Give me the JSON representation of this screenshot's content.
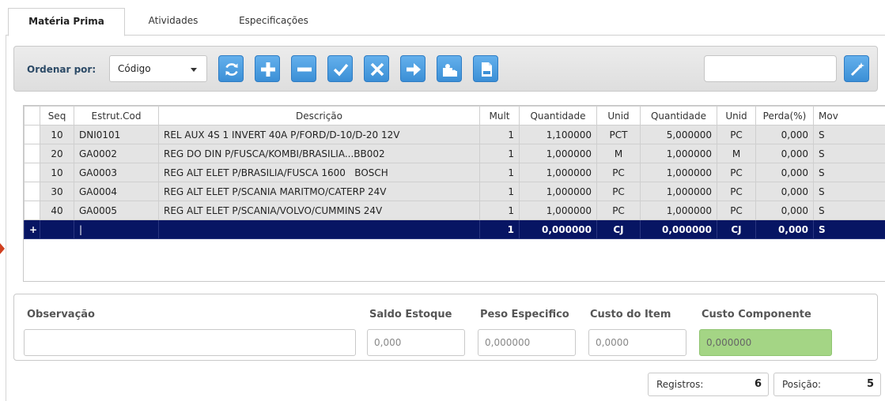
{
  "tabs": [
    {
      "label": "Matéria Prima",
      "active": true
    },
    {
      "label": "Atividades",
      "active": false
    },
    {
      "label": "Especificações",
      "active": false
    }
  ],
  "toolbar": {
    "order_label": "Ordenar por:",
    "order_value": "Código",
    "buttons": [
      "refresh-icon",
      "plus-icon",
      "minus-icon",
      "check-icon",
      "x-icon",
      "arrow-right-icon",
      "puzzle-icon",
      "pdf-icon"
    ],
    "search_value": "",
    "accent": "#3b8fd6"
  },
  "grid": {
    "columns": [
      "",
      "Seq",
      "Estrut.Cod",
      "Descrição",
      "Mult",
      "Quantidade",
      "Unid",
      "Quantidade",
      "Unid",
      "Perda(%)",
      "Mov"
    ],
    "rows": [
      {
        "seq": "10",
        "cod": "DNI0101",
        "desc": "REL AUX 4S 1 INVERT 40A P/FORD/D-10/D-20 12V",
        "mult": "1",
        "qtd1": "1,100000",
        "unid1": "PCT",
        "qtd2": "5,000000",
        "unid2": "PC",
        "perda": "0,000",
        "mov": "S"
      },
      {
        "seq": "20",
        "cod": "GA0002",
        "desc": "REG DO DIN P/FUSCA/KOMBI/BRASILIA...BB002",
        "mult": "1",
        "qtd1": "1,000000",
        "unid1": "M",
        "qtd2": "1,000000",
        "unid2": "M",
        "perda": "0,000",
        "mov": "S"
      },
      {
        "seq": "10",
        "cod": "GA0003",
        "desc": "REG ALT ELET P/BRASILIA/FUSCA 1600   BOSCH",
        "mult": "1",
        "qtd1": "1,000000",
        "unid1": "PC",
        "qtd2": "1,000000",
        "unid2": "PC",
        "perda": "0,000",
        "mov": "S"
      },
      {
        "seq": "30",
        "cod": "GA0004",
        "desc": "REG ALT ELET P/SCANIA MARITMO/CATERP 24V",
        "mult": "1",
        "qtd1": "1,000000",
        "unid1": "PC",
        "qtd2": "1,000000",
        "unid2": "PC",
        "perda": "0,000",
        "mov": "S"
      },
      {
        "seq": "40",
        "cod": "GA0005",
        "desc": "REG ALT ELET P/SCANIA/VOLVO/CUMMINS 24V",
        "mult": "1",
        "qtd1": "1,000000",
        "unid1": "PC",
        "qtd2": "1,000000",
        "unid2": "PC",
        "perda": "0,000",
        "mov": "S"
      }
    ],
    "new_row": {
      "marker": "+",
      "seq": "",
      "cod": "|",
      "desc": "",
      "mult": "1",
      "qtd1": "0,000000",
      "unid1": "CJ",
      "qtd2": "0,000000",
      "unid2": "CJ",
      "perda": "0,000",
      "mov": "S"
    },
    "selected_color": "#071563"
  },
  "panel": {
    "observacao_label": "Observação",
    "observacao_value": "",
    "saldo_label": "Saldo Estoque",
    "saldo_value": "0,000",
    "peso_label": "Peso Especifico",
    "peso_value": "0,000000",
    "custo_item_label": "Custo do Item",
    "custo_item_value": "0,0000",
    "custo_comp_label": "Custo Componente",
    "custo_comp_value": "0,000000"
  },
  "footer": {
    "registros_label": "Registros:",
    "registros_value": "6",
    "posicao_label": "Posição:",
    "posicao_value": "5"
  }
}
